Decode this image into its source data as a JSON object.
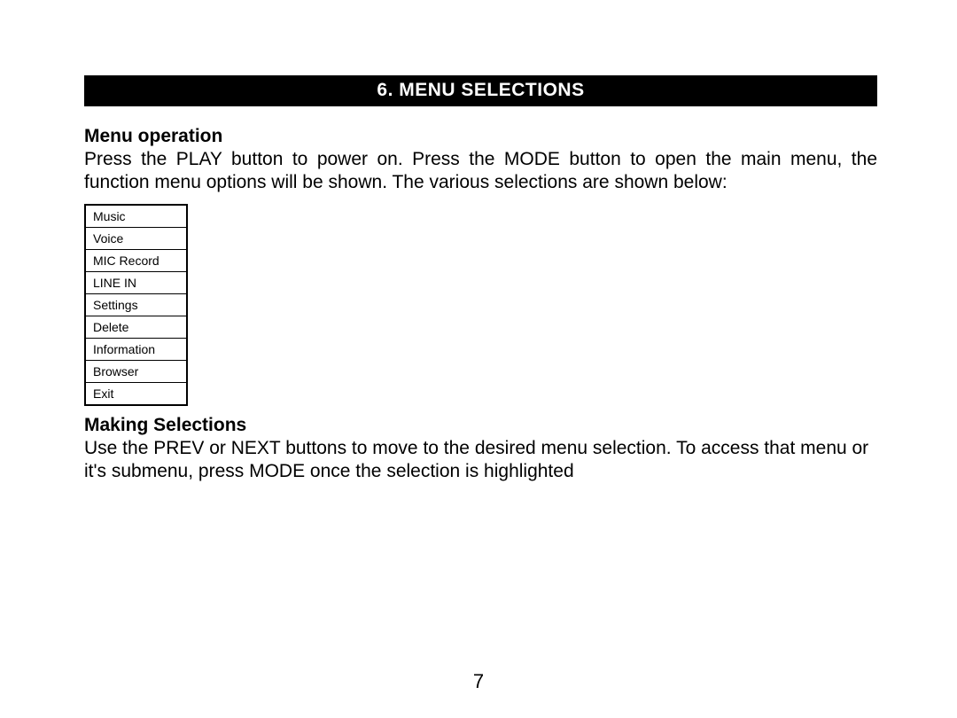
{
  "section_header": "6.  MENU SELECTIONS",
  "sub1": {
    "heading": "Menu operation",
    "text": "Press the PLAY button to power on. Press the MODE button to open the main menu, the function menu options will be shown. The various selections are shown below:"
  },
  "menu_items": [
    "Music",
    "Voice",
    "MIC Record",
    "LINE IN",
    "Settings",
    "Delete",
    "Information",
    "Browser",
    "Exit"
  ],
  "sub2": {
    "heading": "Making Selections",
    "text": "Use the PREV or NEXT buttons to move to the desired menu selection.  To access that menu or it's submenu, press MODE once the selection is highlighted"
  },
  "page_number": "7"
}
